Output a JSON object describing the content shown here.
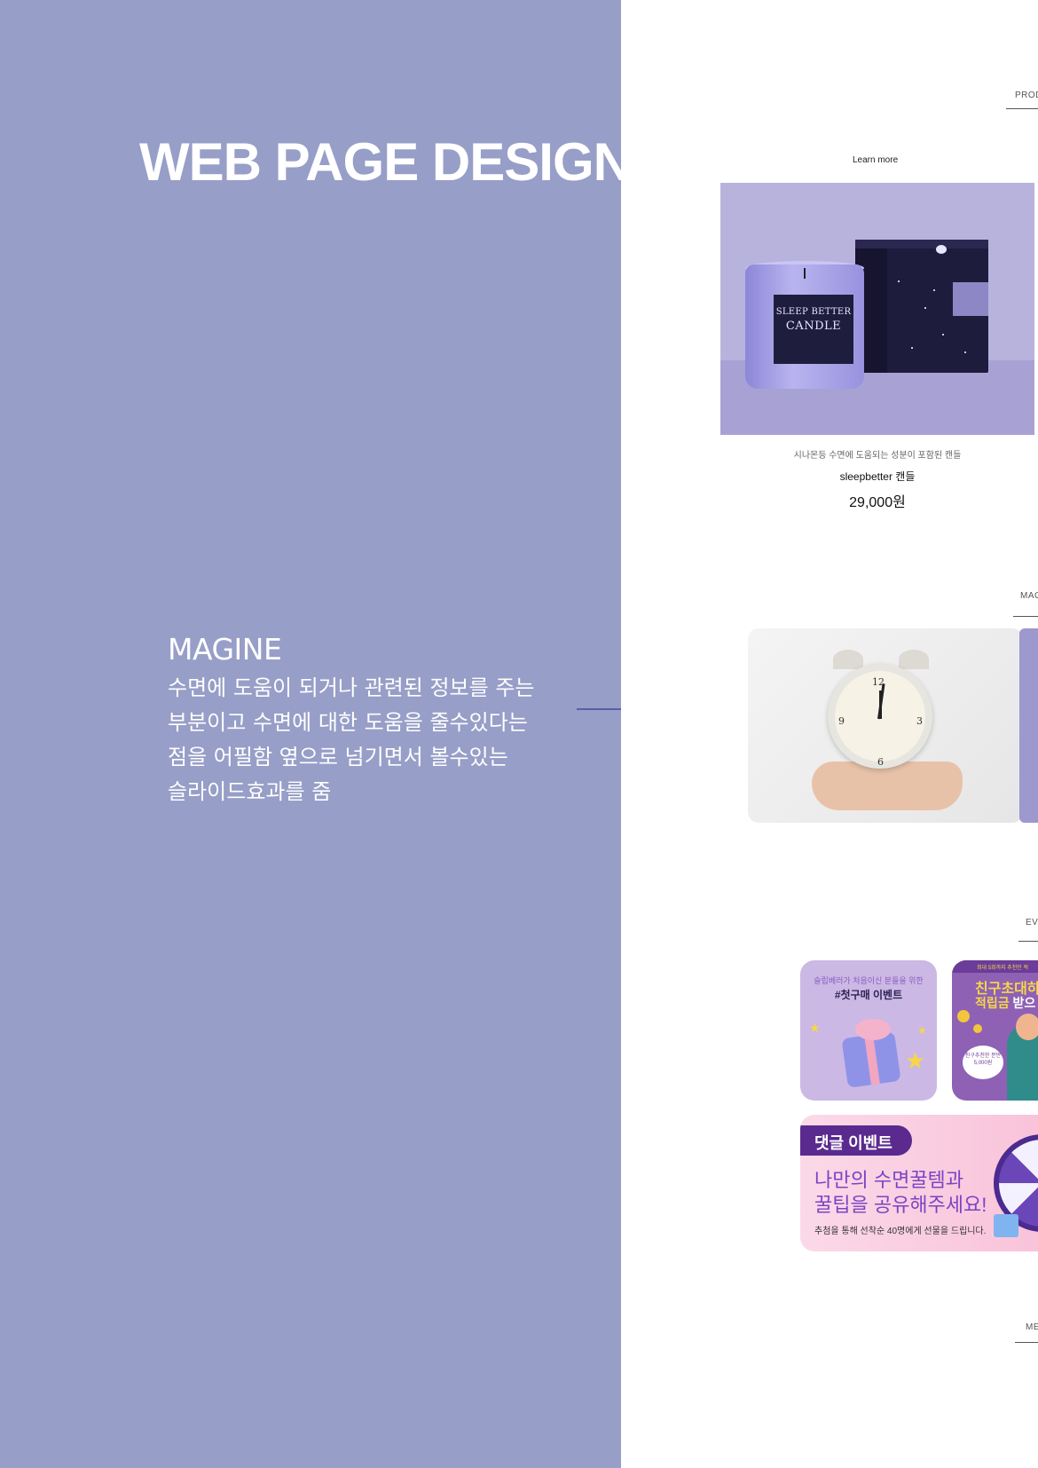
{
  "left": {
    "title": "WEB PAGE DESIGN",
    "annotation": {
      "title": "MAGINE",
      "lines": [
        "수면에 도움이 되거나 관련된 정보를 주는",
        "부분이고 수면에 대한 도움을 줄수있다는",
        "점을 어필함 옆으로 넘기면서 볼수있는",
        "슬라이드효과를 줌"
      ]
    }
  },
  "right": {
    "sections": {
      "product": "PROD",
      "magazine": "MAG",
      "event": "EVE",
      "member": "ME"
    },
    "learn_more": "Learn more",
    "product": {
      "jar_label_1": "SLEEP BETTER",
      "jar_label_2": "CANDLE",
      "description": "시나몬등 수면에 도움되는 성분이 포함된 캔들",
      "name": "sleepbetter 캔들",
      "price": "29,000원"
    },
    "events": {
      "card1_sub": "슬립베러가 처음이신 분들을 위한",
      "card1_title": "#첫구매 이벤트",
      "card2_top": "최대 5회까지 추천인 적",
      "card2_title": "친구초대하",
      "card2_title2_a": "적립금",
      "card2_title2_b": " 받으",
      "card2_bubble": "친구추천한 분만 5,000원",
      "banner_pill": "댓글 이벤트",
      "banner_line1": "나만의 수면꿀템과",
      "banner_line2": "꿀팁을 공유해주세요!",
      "banner_small": "추첨을 통해 선착순 40명에게 선물을 드립니다."
    }
  },
  "colors": {
    "left_bg": "#979ec7",
    "accent": "#5a5fa6",
    "card_purple": "#cbb8e4",
    "banner_pink": "#f9c3da"
  }
}
